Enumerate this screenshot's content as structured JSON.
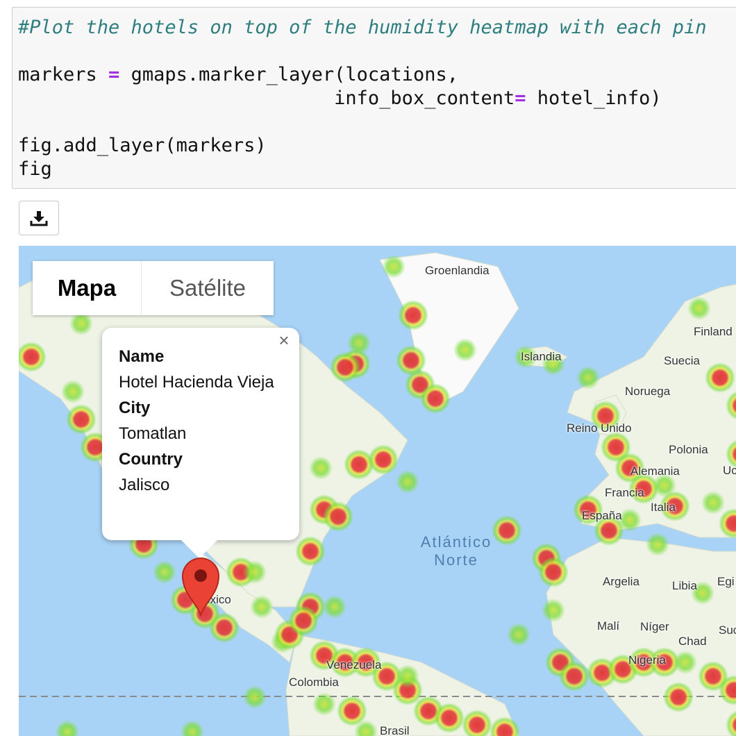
{
  "code": {
    "comment": "#Plot the hotels on top of the humidity heatmap with each pin",
    "line1_pre": "markers ",
    "line1_op": "=",
    "line1_post": " gmaps.marker_layer(locations,",
    "line2_pre": "                            info_box_content",
    "line2_op": "=",
    "line2_post": " hotel_info)",
    "line3": "fig.add_layer(markers)",
    "line4": "fig"
  },
  "toolbar": {
    "download_icon": "download-icon"
  },
  "map": {
    "tabs": {
      "map_label": "Mapa",
      "satellite_label": "Satélite",
      "selected": "Mapa"
    },
    "ocean_label": "Atlántico\nNorte",
    "labels": [
      "Groenlandia",
      "Islandia",
      "Finland",
      "Suecia",
      "Noruega",
      "Reino Unido",
      "Polonia",
      "Alemania",
      "Uc",
      "Francia",
      "Italia",
      "España",
      "Argelia",
      "Libia",
      "Egi",
      "Malí",
      "Níger",
      "Chad",
      "Suc",
      "Nigeria",
      "México",
      "Venezuela",
      "Colombia",
      "Brasil"
    ],
    "info_window": {
      "name_label": "Name",
      "name_value": "Hotel Hacienda Vieja",
      "city_label": "City",
      "city_value": "Tomatlan",
      "country_label": "Country",
      "country_value": "Jalisco",
      "close_icon": "close-icon"
    },
    "marker_icon": "map-pin-icon",
    "colors": {
      "heat_low": "#7bdc3a",
      "heat_mid": "#e6e63a",
      "heat_high": "#e23b3b",
      "ocean": "#a9d3f6",
      "land": "#eef3e6"
    }
  }
}
